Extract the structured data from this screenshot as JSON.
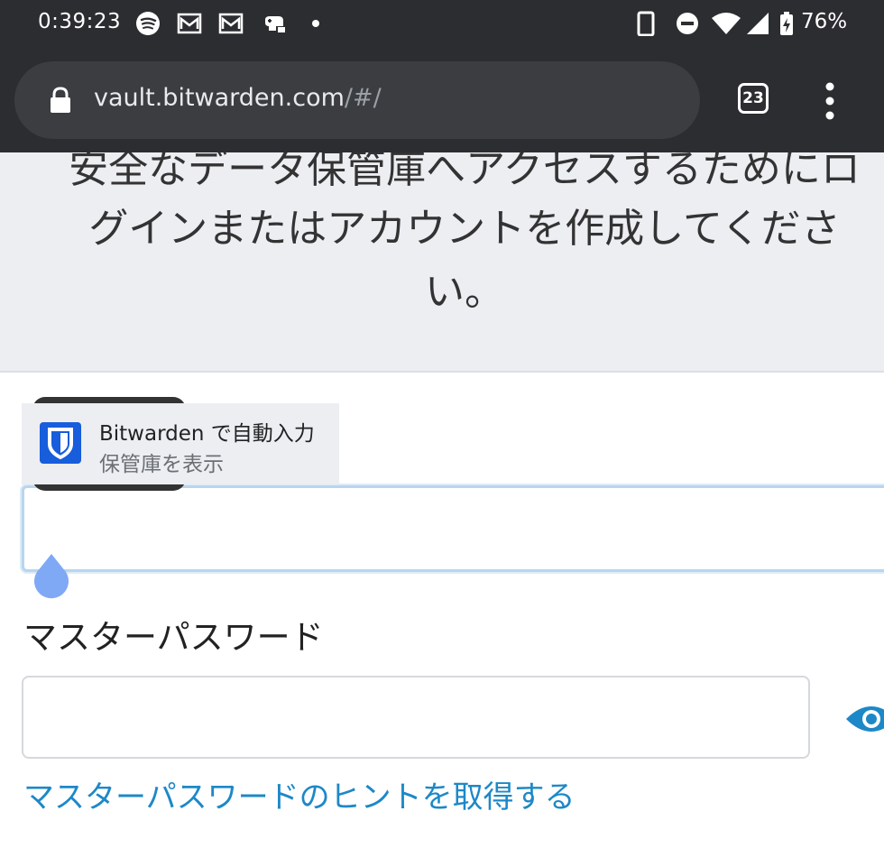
{
  "status_bar": {
    "time": "0:39:23",
    "battery": "76%",
    "icons": [
      "spotify-icon",
      "gmail-icon",
      "gmail-icon",
      "game-icon",
      "dot-icon",
      "phone-icon",
      "dnd-icon",
      "wifi-icon",
      "signal-icon",
      "battery-icon"
    ]
  },
  "browser": {
    "url_host": "vault.bitwarden.com",
    "url_path": "/#/",
    "tab_count": "23"
  },
  "page": {
    "heading_line1": "安全なデータ保管庫へアクセスするためにロ",
    "heading_line2": "グインまたはアカウントを作成してくださ",
    "heading_line3": "い。",
    "password_label": "マスターパスワード",
    "hint_link": "マスターパスワードのヒントを取得する"
  },
  "autofill": {
    "title": "Bitwarden で自動入力",
    "subtitle": "保管庫を表示"
  },
  "colors": {
    "chrome_bg": "#2c2d30",
    "link": "#1d88c7",
    "bitwarden_blue": "#175ddc",
    "focus_border": "#b9d5ee"
  }
}
